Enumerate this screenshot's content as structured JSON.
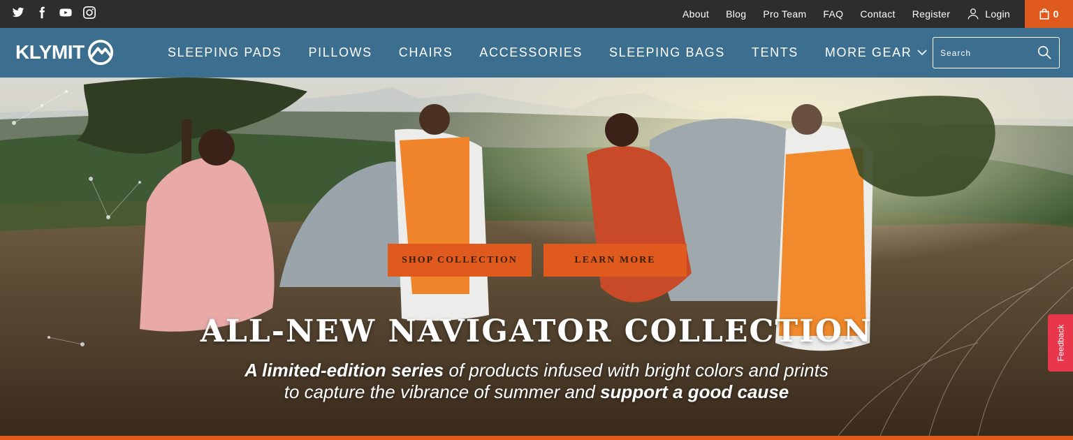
{
  "topbar": {
    "social": [
      "twitter-icon",
      "facebook-icon",
      "youtube-icon",
      "instagram-icon"
    ],
    "links": {
      "about": "About",
      "blog": "Blog",
      "pro_team": "Pro Team",
      "faq": "FAQ",
      "contact": "Contact",
      "register": "Register",
      "login": "Login"
    },
    "cart_count": "0"
  },
  "brand": {
    "name": "KLYMIT"
  },
  "nav": {
    "items": [
      "SLEEPING PADS",
      "PILLOWS",
      "CHAIRS",
      "ACCESSORIES",
      "SLEEPING BAGS",
      "TENTS",
      "MORE GEAR"
    ]
  },
  "search": {
    "placeholder": "Search"
  },
  "hero": {
    "shop_button": "SHOP COLLECTION",
    "learn_button": "LEARN MORE",
    "headline": "ALL-NEW NAVIGATOR COLLECTION",
    "sub_line1_bold": "A limited-edition series",
    "sub_line1_rest": " of products infused with bright colors and prints",
    "sub_line2_rest": "to capture the vibrance of summer and ",
    "sub_line2_bold": "support a good cause"
  },
  "feedback": {
    "label": "Feedback"
  },
  "colors": {
    "topbar": "#2d2d2d",
    "nav": "#3b6e8f",
    "accent": "#e05a1d",
    "feedback": "#e8364a"
  }
}
